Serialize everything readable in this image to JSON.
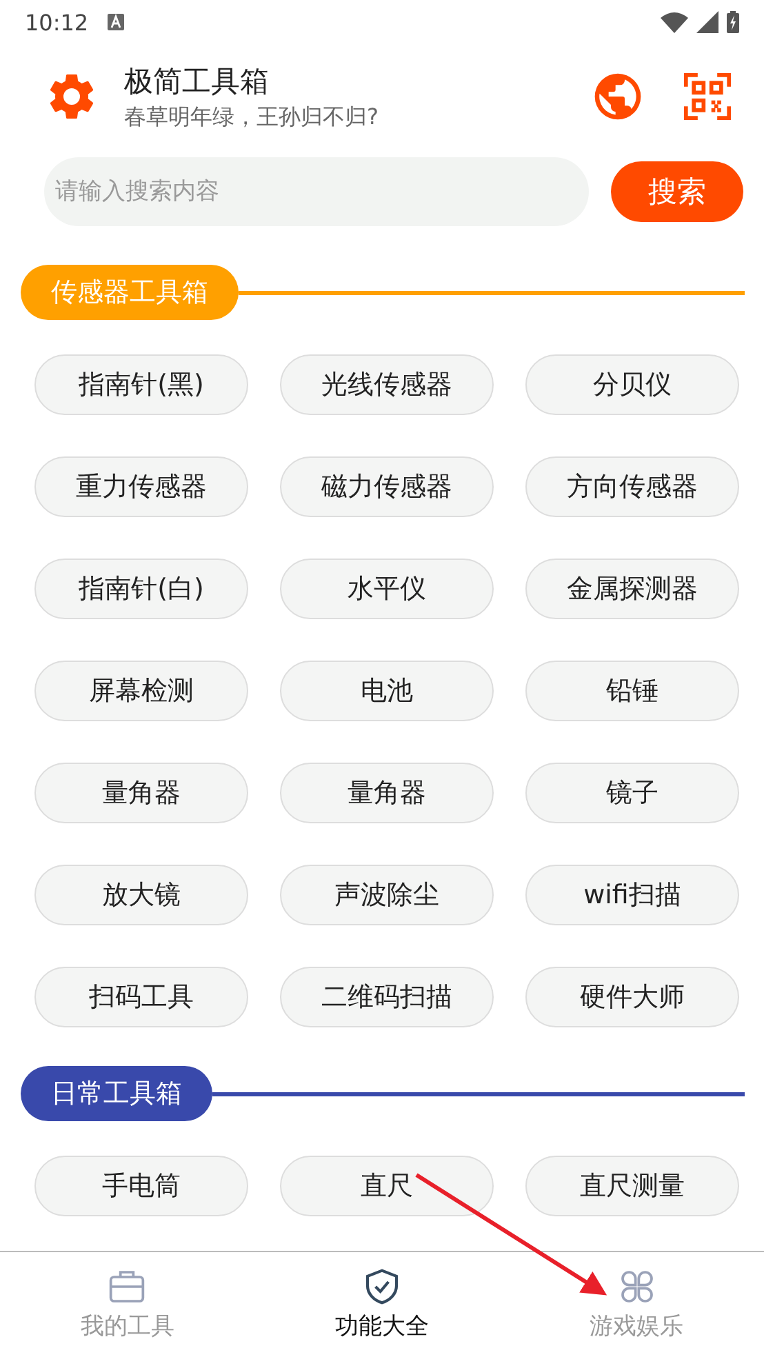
{
  "status_bar": {
    "time": "10:12"
  },
  "header": {
    "title": "极简工具箱",
    "subtitle": "春草明年绿，王孙归不归?"
  },
  "search": {
    "placeholder": "请输入搜索内容",
    "button": "搜索"
  },
  "sections": [
    {
      "title": "传感器工具箱",
      "color": "#ffa000",
      "tools": [
        "指南针(黑)",
        "光线传感器",
        "分贝仪",
        "重力传感器",
        "磁力传感器",
        "方向传感器",
        "指南针(白)",
        "水平仪",
        "金属探测器",
        "屏幕检测",
        "电池",
        "铅锤",
        "量角器",
        "量角器",
        "镜子",
        "放大镜",
        "声波除尘",
        "wifi扫描",
        "扫码工具",
        "二维码扫描",
        "硬件大师"
      ]
    },
    {
      "title": "日常工具箱",
      "color": "#3949ab",
      "tools": [
        "手电筒",
        "直尺",
        "直尺测量"
      ]
    }
  ],
  "bottom_nav": [
    {
      "label": "我的工具",
      "kind": "toolbox",
      "selected": false
    },
    {
      "label": "功能大全",
      "kind": "shield",
      "selected": true
    },
    {
      "label": "游戏娱乐",
      "kind": "clover",
      "selected": false
    }
  ]
}
